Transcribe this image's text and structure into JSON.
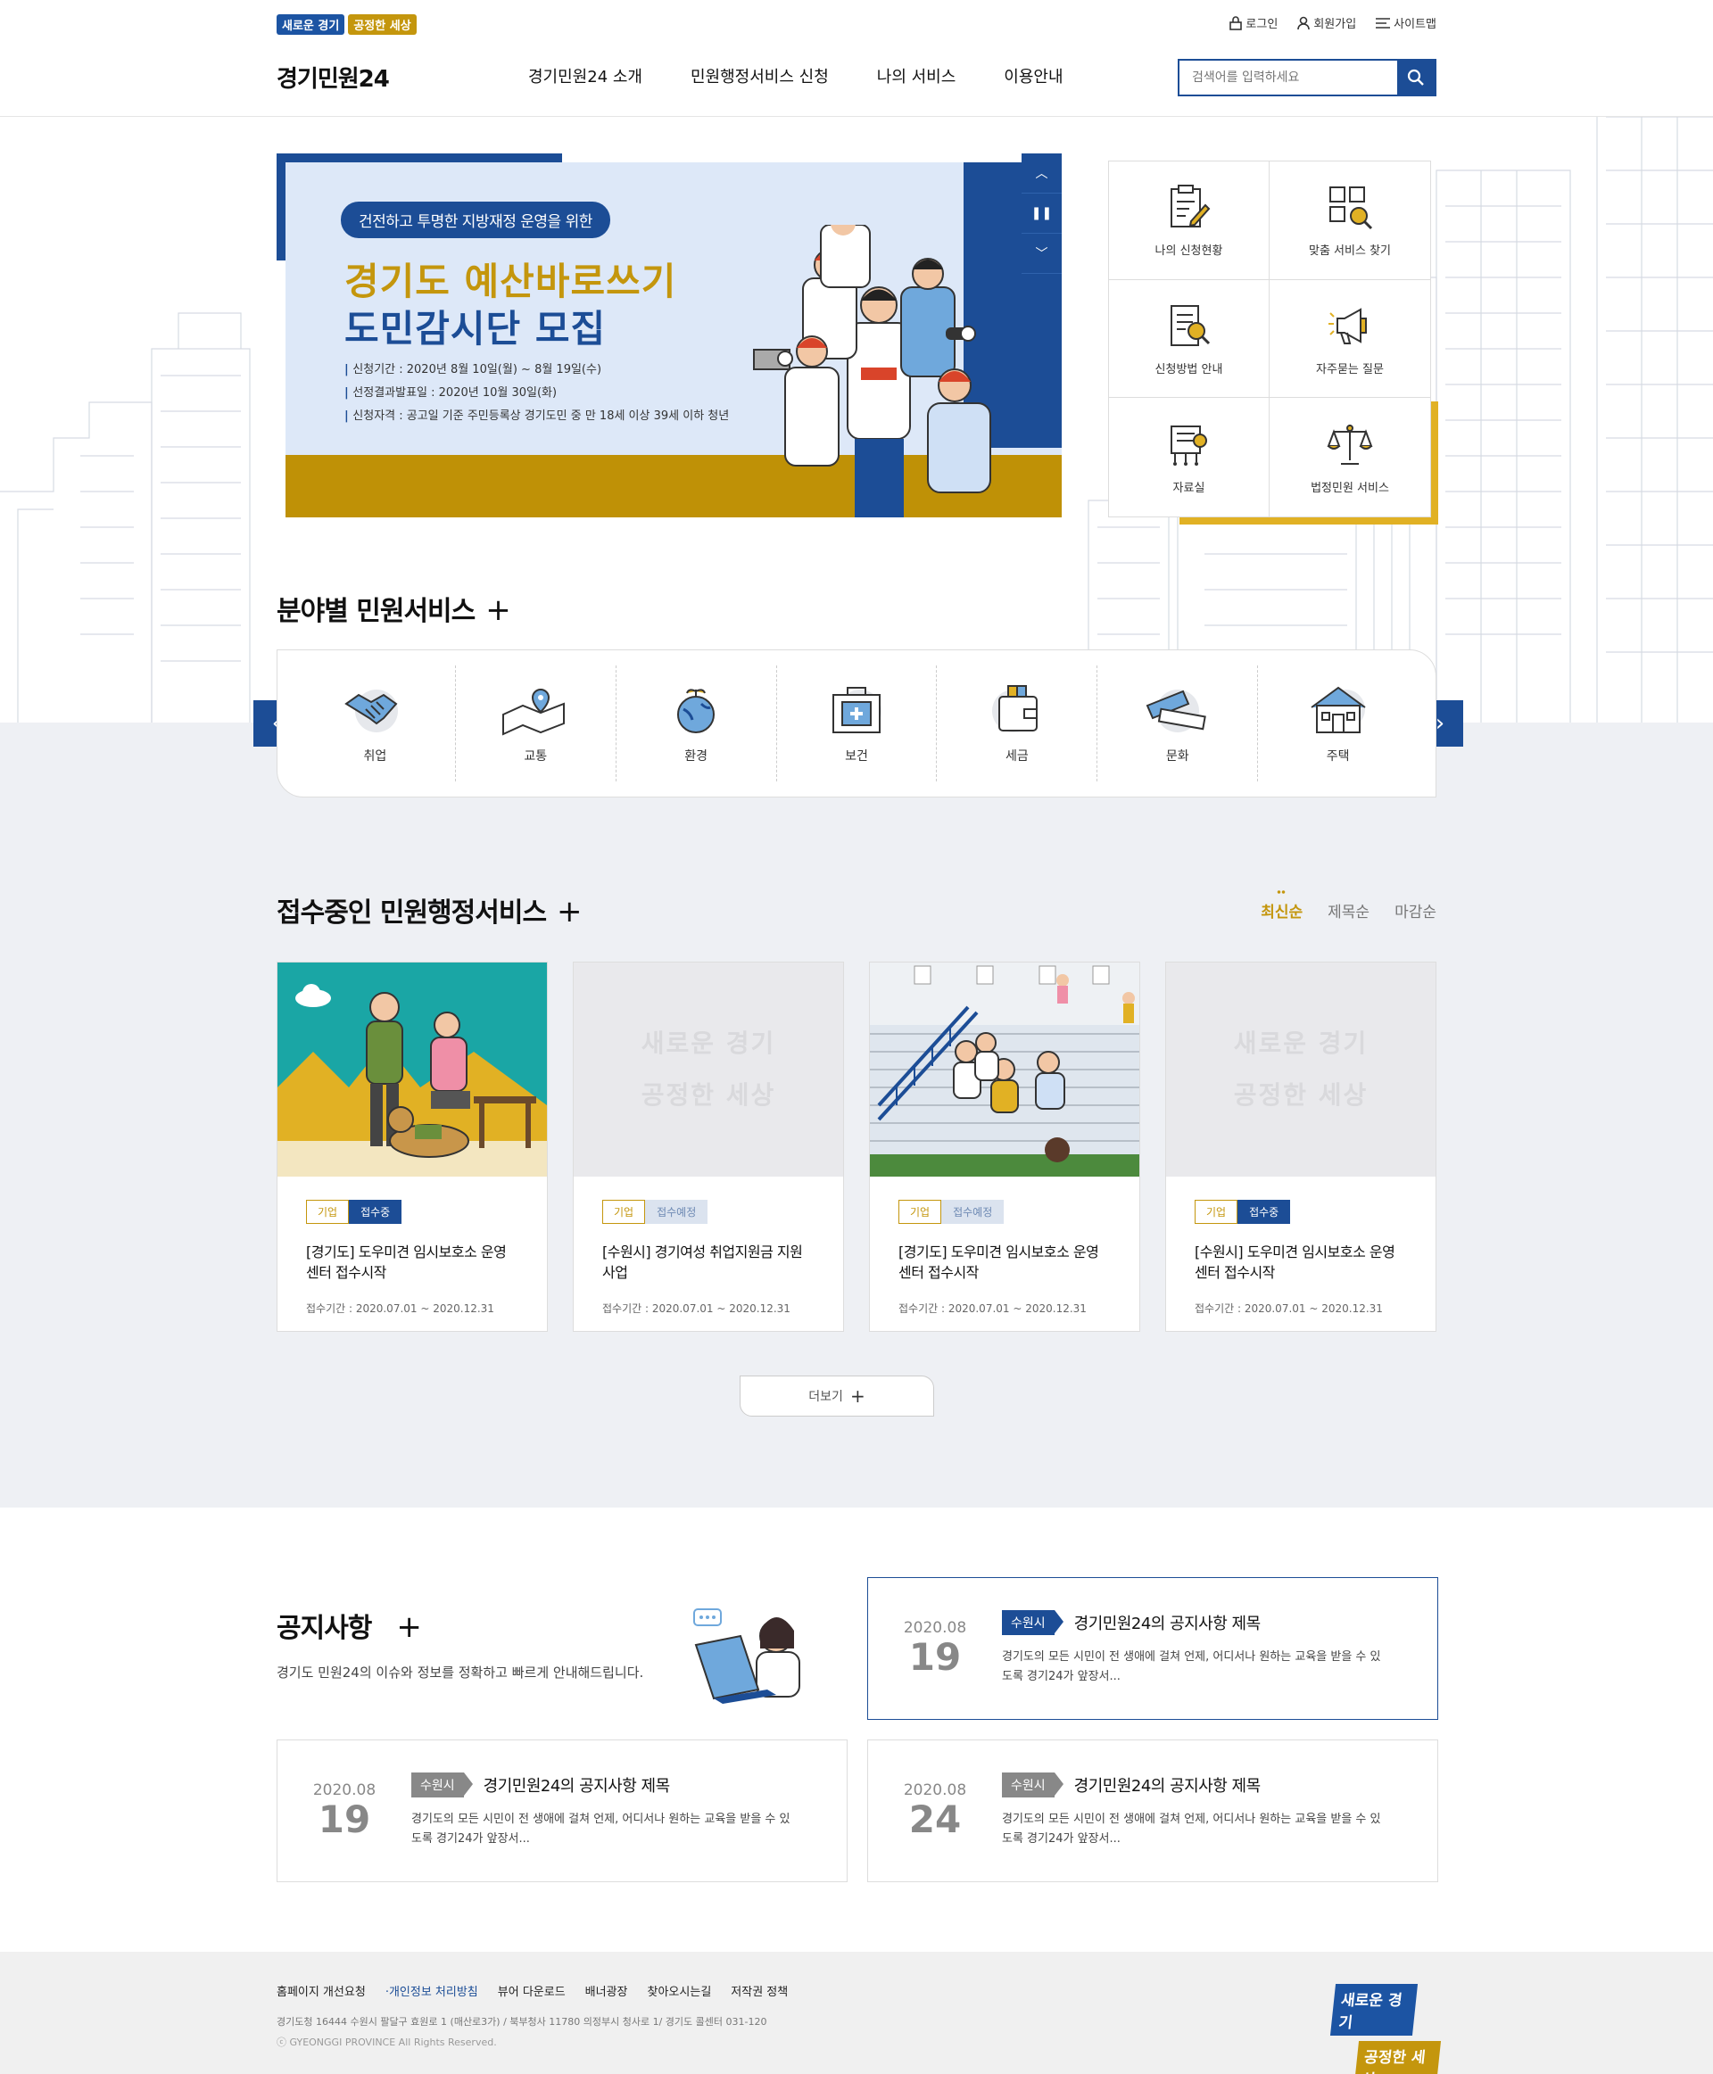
{
  "header": {
    "badge_1": "새로운 경기",
    "badge_2": "공정한 세상",
    "login": "로그인",
    "signup": "회원가입",
    "sitemap": "사이트맵",
    "brand": "경기민원24",
    "menu": [
      "경기민원24 소개",
      "민원행정서비스 신청",
      "나의 서비스",
      "이용안내"
    ],
    "search_placeholder": "검색어를 입력하세요"
  },
  "banner": {
    "pill": "건전하고 투명한 지방재정 운영을 위한",
    "title_1": "경기도 예산바로쓰기",
    "title_2": "도민감시단 모집",
    "info": [
      "신청기간 : 2020년 8월 10일(월) ~ 8월 19일(수)",
      "선정결과발표일 : 2020년 10월 30일(화)",
      "신청자격 : 공고일 기준 주민등록상 경기도민 중 만 18세 이상 39세 이하 청년"
    ]
  },
  "quick_menu": [
    {
      "label": "나의 신청현황",
      "icon": "clipboard-pen-icon"
    },
    {
      "label": "맞춤 서비스 찾기",
      "icon": "grid-search-icon"
    },
    {
      "label": "신청방법 안내",
      "icon": "book-search-icon"
    },
    {
      "label": "자주묻는 질문",
      "icon": "megaphone-icon"
    },
    {
      "label": "자료실",
      "icon": "archive-icon"
    },
    {
      "label": "법정민원 서비스",
      "icon": "scales-icon"
    }
  ],
  "fields": {
    "title": "분야별 민원서비스",
    "items": [
      {
        "label": "취업",
        "icon": "handshake-icon"
      },
      {
        "label": "교통",
        "icon": "map-pin-icon"
      },
      {
        "label": "환경",
        "icon": "globe-sprout-icon"
      },
      {
        "label": "보건",
        "icon": "medical-kit-icon"
      },
      {
        "label": "세금",
        "icon": "wallet-icon"
      },
      {
        "label": "문화",
        "icon": "ticket-icon"
      },
      {
        "label": "주택",
        "icon": "house-icon"
      }
    ]
  },
  "services": {
    "title": "접수중인 민원행정서비스",
    "sort": [
      "최신순",
      "제목순",
      "마감순"
    ],
    "cards": [
      {
        "tag": "기업",
        "status": "접수중",
        "title": "[경기도] 도우미견 임시보호소 운영 센터 접수시작",
        "period": "접수기간 : 2020.07.01 ~ 2020.12.31"
      },
      {
        "tag": "기업",
        "status": "접수예정",
        "title": "[수원시] 경기여성 취업지원금 지원 사업",
        "period": "접수기간 : 2020.07.01 ~ 2020.12.31"
      },
      {
        "tag": "기업",
        "status": "접수예정",
        "title": "[경기도] 도우미견 임시보호소 운영 센터 접수시작",
        "period": "접수기간 : 2020.07.01 ~ 2020.12.31"
      },
      {
        "tag": "기업",
        "status": "접수중",
        "title": "[수원시] 도우미견 임시보호소 운영 센터 접수시작",
        "period": "접수기간 : 2020.07.01 ~ 2020.12.31"
      }
    ],
    "placeholder_1": "새로운 경기",
    "placeholder_2": "공정한 세상",
    "more": "더보기"
  },
  "notices": {
    "title": "공지사항",
    "desc": "경기도 민원24의 이슈와 정보를 정확하고 빠르게 안내해드립니다.",
    "items": [
      {
        "ym": "2020.08",
        "day": "19",
        "tag": "수원시",
        "title": "경기민원24의 공지사항 제목",
        "text": "경기도의 모든 시민이 전 생애에 걸쳐 언제, 어디서나 원하는 교육을 받을 수 있도록 경기24가 앞장서..."
      },
      {
        "ym": "2020.08",
        "day": "19",
        "tag": "수원시",
        "title": "경기민원24의 공지사항 제목",
        "text": "경기도의 모든 시민이 전 생애에 걸쳐 언제, 어디서나 원하는 교육을 받을 수 있도록 경기24가 앞장서..."
      },
      {
        "ym": "2020.08",
        "day": "24",
        "tag": "수원시",
        "title": "경기민원24의 공지사항 제목",
        "text": "경기도의 모든 시민이 전 생애에 걸쳐 언제, 어디서나 원하는 교육을 받을 수 있도록 경기24가 앞장서..."
      }
    ]
  },
  "footer": {
    "links": [
      "홈페이지 개선요청",
      "·개인정보 처리방침",
      "뷰어 다운로드",
      "배너광장",
      "찾아오시는길",
      "저작권 정책"
    ],
    "address": "경기도청 16444 수원시 팔달구 효원로 1 (매산로3가) / 북부청사 11780 의정부시 청사로 1/ 경기도 콜센터 031-120",
    "copyright": "ⓒ GYEONGGI PROVINCE All Rights Reserved.",
    "logo_1": "새로운 경기",
    "logo_2": "공정한 세상"
  },
  "colors": {
    "primary": "#1c4d96",
    "gold": "#c4960d",
    "band": "#eef0f4"
  }
}
